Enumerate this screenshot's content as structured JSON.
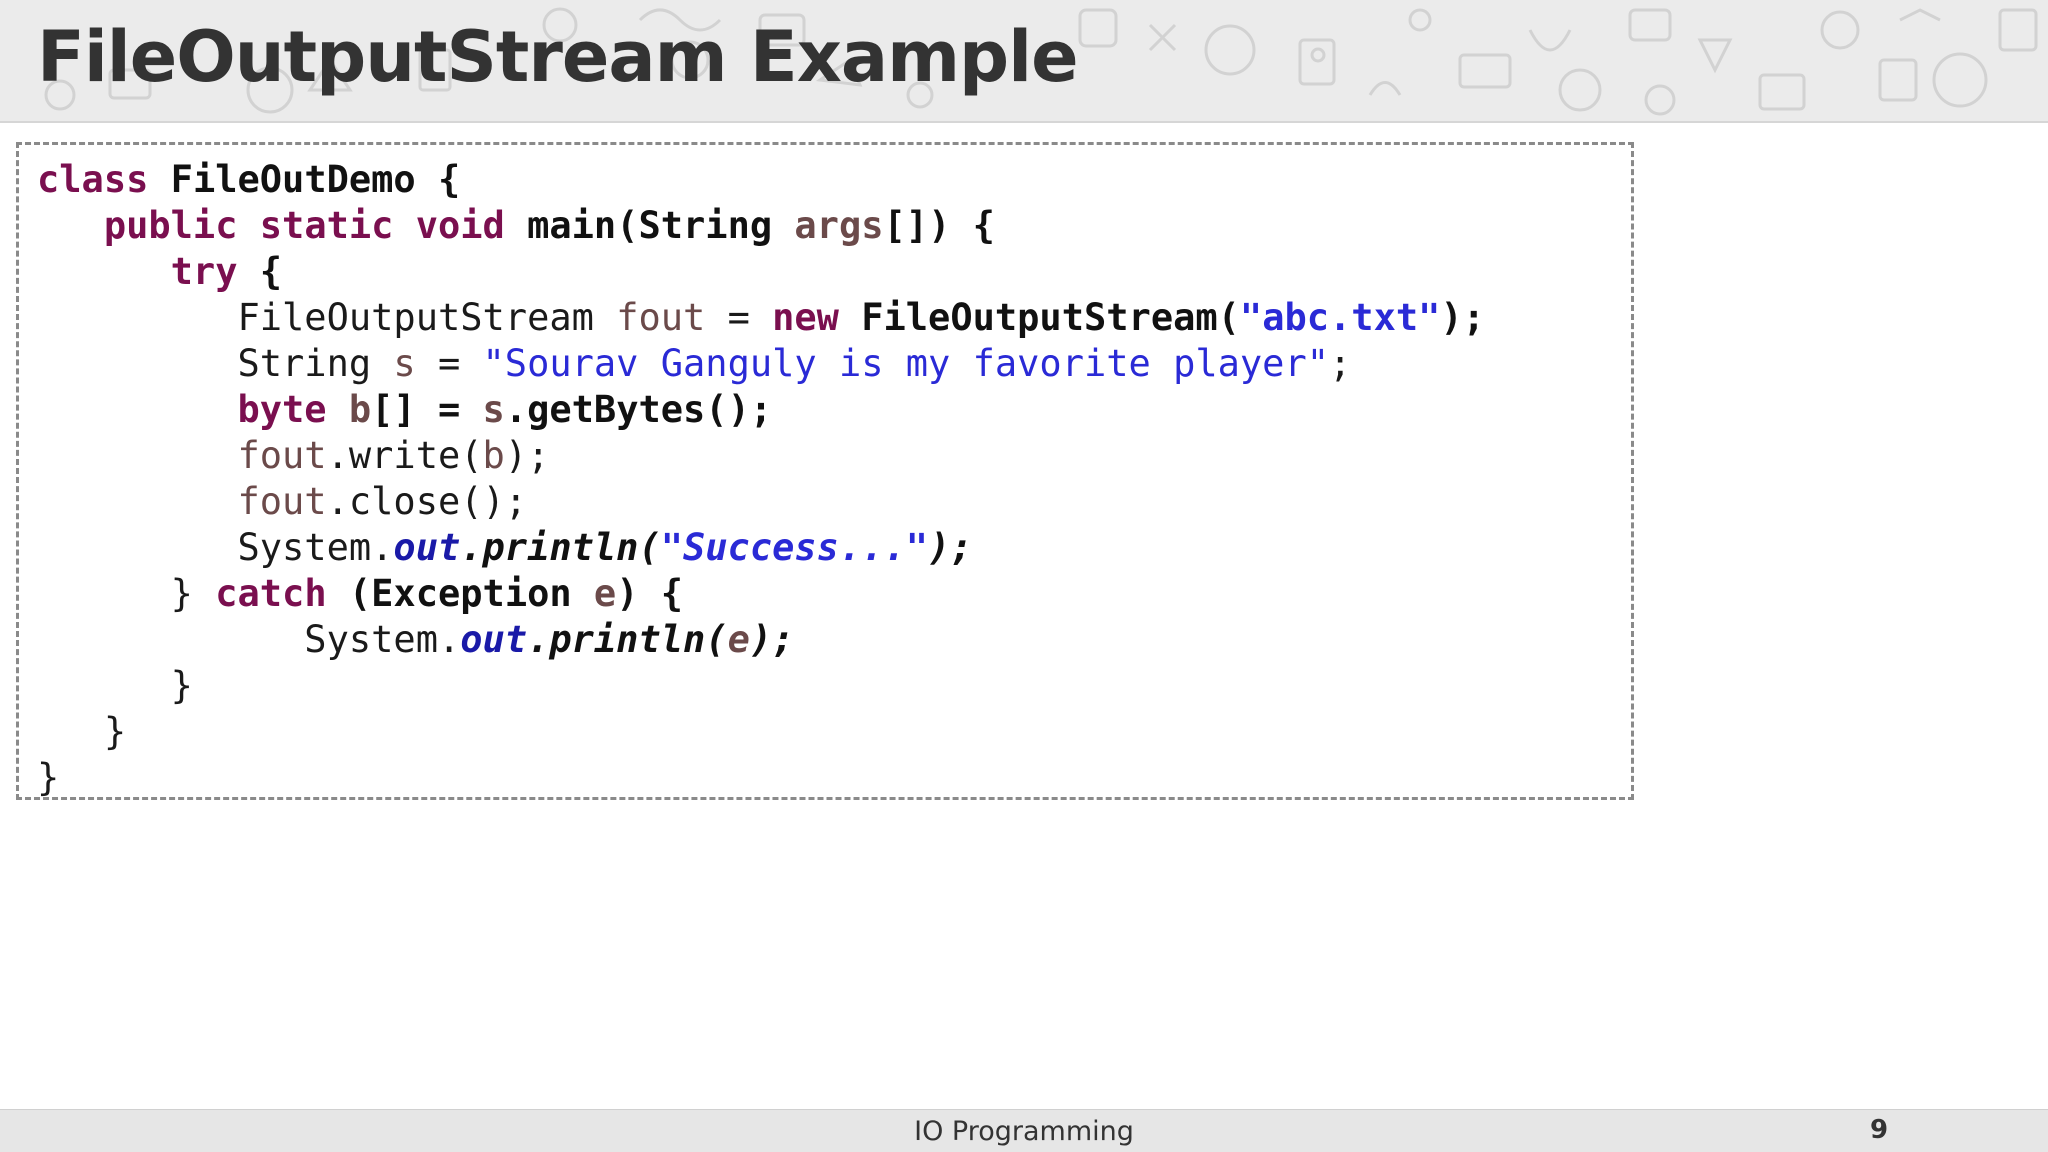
{
  "title": "FileOutputStream Example",
  "footer": {
    "label": "IO Programming",
    "page_number": "9"
  },
  "code_lines": [
    [
      [
        "kw",
        "class"
      ],
      [
        "b",
        " FileOutDemo {"
      ]
    ],
    [
      [
        "t",
        "   "
      ],
      [
        "kw",
        "public"
      ],
      [
        "t",
        " "
      ],
      [
        "kw",
        "static"
      ],
      [
        "t",
        " "
      ],
      [
        "kw",
        "void"
      ],
      [
        "b",
        " main(String "
      ],
      [
        "varb",
        "args"
      ],
      [
        "b",
        "[]) {"
      ]
    ],
    [
      [
        "t",
        "      "
      ],
      [
        "kw",
        "try"
      ],
      [
        "b",
        " {"
      ]
    ],
    [
      [
        "t",
        "         FileOutputStream "
      ],
      [
        "var",
        "fout"
      ],
      [
        "t",
        " = "
      ],
      [
        "kw",
        "new"
      ],
      [
        "b",
        " FileOutputStream("
      ],
      [
        "strb",
        "\"abc.txt\""
      ],
      [
        "b",
        ");"
      ]
    ],
    [
      [
        "t",
        "         String "
      ],
      [
        "var",
        "s"
      ],
      [
        "t",
        " = "
      ],
      [
        "str",
        "\"Sourav Ganguly is my favorite player\""
      ],
      [
        "t",
        ";"
      ]
    ],
    [
      [
        "t",
        "         "
      ],
      [
        "kw",
        "byte"
      ],
      [
        "t",
        " "
      ],
      [
        "varb",
        "b"
      ],
      [
        "b",
        "[] = "
      ],
      [
        "varb",
        "s"
      ],
      [
        "b",
        ".getBytes();"
      ]
    ],
    [
      [
        "t",
        "         "
      ],
      [
        "var",
        "fout"
      ],
      [
        "t",
        ".write("
      ],
      [
        "var",
        "b"
      ],
      [
        "t",
        ");"
      ]
    ],
    [
      [
        "t",
        "         "
      ],
      [
        "var",
        "fout"
      ],
      [
        "t",
        ".close();"
      ]
    ],
    [
      [
        "t",
        "         System."
      ],
      [
        "fld",
        "out"
      ],
      [
        "mth",
        ".println("
      ],
      [
        "stri",
        "\"Success...\""
      ],
      [
        "mth",
        ");"
      ]
    ],
    [
      [
        "t",
        "      } "
      ],
      [
        "kw",
        "catch"
      ],
      [
        "b",
        " (Exception "
      ],
      [
        "varb",
        "e"
      ],
      [
        "b",
        ") {"
      ]
    ],
    [
      [
        "t",
        "            System."
      ],
      [
        "fld",
        "out"
      ],
      [
        "mth",
        ".println("
      ],
      [
        "vari",
        "e"
      ],
      [
        "mth",
        ");"
      ]
    ],
    [
      [
        "t",
        "      }"
      ]
    ],
    [
      [
        "t",
        "   }"
      ]
    ],
    [
      [
        "t",
        "}"
      ]
    ]
  ]
}
